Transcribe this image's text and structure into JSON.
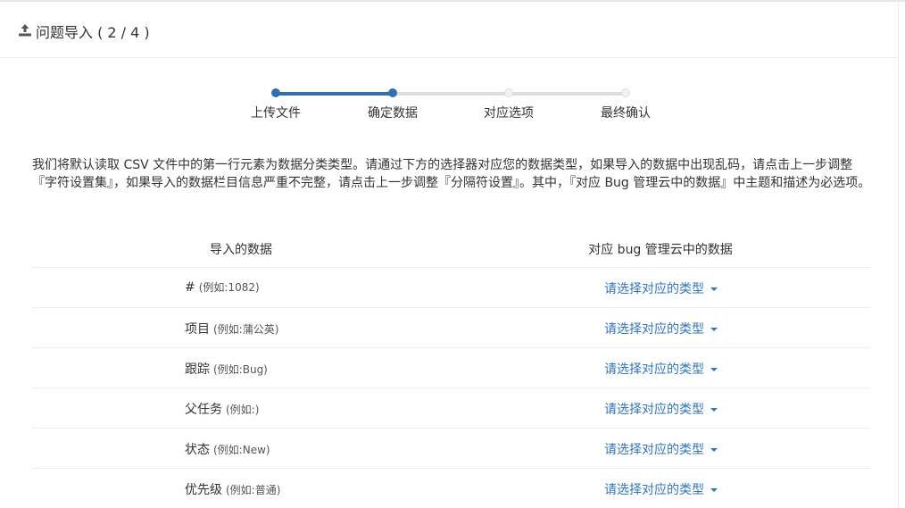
{
  "header": {
    "title": "问题导入 ( 2 / 4 )",
    "icon": "upload-icon"
  },
  "steps": [
    {
      "label": "上传文件",
      "state": "done"
    },
    {
      "label": "确定数据",
      "state": "active"
    },
    {
      "label": "对应选项",
      "state": "pending"
    },
    {
      "label": "最终确认",
      "state": "pending"
    }
  ],
  "description": "我们将默认读取 CSV 文件中的第一行元素为数据分类类型。请通过下方的选择器对应您的数据类型，如果导入的数据中出现乱码，请点击上一步调整『字符设置集』，如果导入的数据栏目信息严重不完整，请点击上一步调整『分隔符设置』。其中，『对应 Bug 管理云中的数据』中主题和描述为必选项。",
  "table": {
    "columns": [
      "导入的数据",
      "对应 bug 管理云中的数据"
    ],
    "rows": [
      {
        "field": "#",
        "example": "(例如:1082)",
        "select": "请选择对应的类型"
      },
      {
        "field": "项目",
        "example": "(例如:蒲公英)",
        "select": "请选择对应的类型"
      },
      {
        "field": "跟踪",
        "example": "(例如:Bug)",
        "select": "请选择对应的类型"
      },
      {
        "field": "父任务",
        "example": "(例如:)",
        "select": "请选择对应的类型"
      },
      {
        "field": "状态",
        "example": "(例如:New)",
        "select": "请选择对应的类型"
      },
      {
        "field": "优先级",
        "example": "(例如:普通)",
        "select": "请选择对应的类型"
      }
    ]
  },
  "colors": {
    "accent": "#2f6fb0",
    "link": "#3174c0",
    "pending": "#dddddd"
  }
}
